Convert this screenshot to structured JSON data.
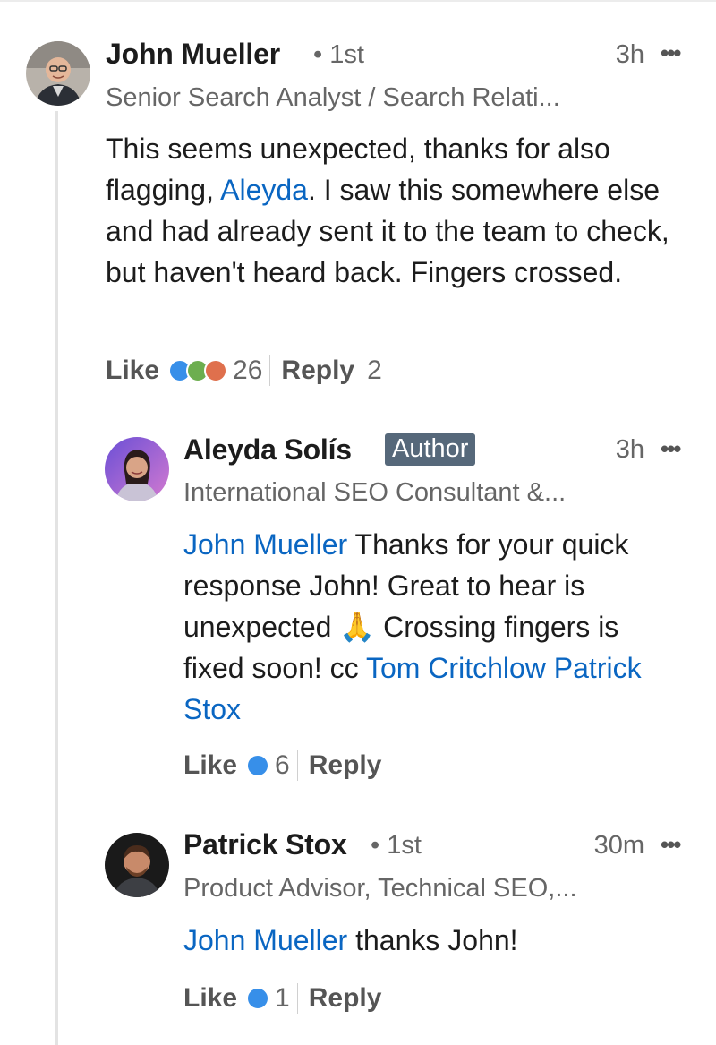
{
  "comments": [
    {
      "author": "John Mueller",
      "degree": "• 1st",
      "time": "3h",
      "more": "•••",
      "headline": "Senior Search Analyst / Search Relati...",
      "text_before": "This seems unexpected, thanks for also flagging, ",
      "mention": "Aleyda",
      "text_after": ". I saw this somewhere else and had already sent it to the team to check, but haven't heard back. Fingers crossed.",
      "like_label": "Like",
      "like_count": "26",
      "reply_label": "Reply",
      "reply_count": "2",
      "reactions": [
        "like-reaction-icon",
        "celebrate-reaction-icon",
        "love-reaction-icon"
      ]
    },
    {
      "author": "Aleyda Solís",
      "badge": "Author",
      "time": "3h",
      "more": "•••",
      "headline": "International SEO Consultant &...",
      "mention_1": "John Mueller",
      "text_1": " Thanks for your quick response John! Great to hear is unexpected 🙏 Crossing fingers is fixed soon! cc ",
      "mention_2": "Tom Critchlow",
      "text_2": " ",
      "mention_3": "Patrick Stox",
      "like_label": "Like",
      "like_count": "6",
      "reply_label": "Reply",
      "reactions": [
        "like-reaction-icon"
      ]
    },
    {
      "author": "Patrick Stox",
      "degree": "• 1st",
      "time": "30m",
      "more": "•••",
      "headline": "Product Advisor, Technical SEO,...",
      "mention": "John Mueller",
      "text_after": " thanks John!",
      "like_label": "Like",
      "like_count": "1",
      "reply_label": "Reply",
      "reactions": [
        "like-reaction-icon"
      ]
    }
  ],
  "colors": {
    "mention": "#0a66c2",
    "badge_bg": "#56687a",
    "like_reaction": "#378fe9",
    "celebrate_reaction": "#6dae4f",
    "love_reaction": "#df704d"
  }
}
